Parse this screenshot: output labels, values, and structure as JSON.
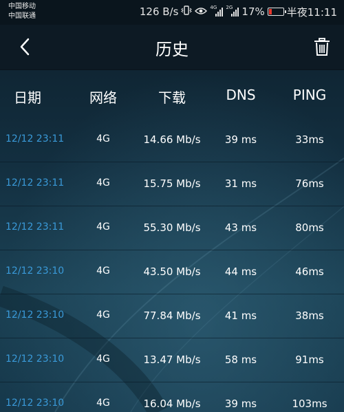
{
  "status_bar": {
    "carrier_1": "中国移动",
    "carrier_2": "中国联通",
    "speed": "126 B/s",
    "net_1": "4G",
    "net_2": "2G",
    "battery": "17%",
    "time": "半夜11:11"
  },
  "app_bar": {
    "title": "历史"
  },
  "table": {
    "headers": [
      "日期",
      "网络",
      "下载",
      "DNS",
      "PING"
    ],
    "rows": [
      {
        "date": "12/12 23:11",
        "network": "4G",
        "download": "14.66 Mb/s",
        "dns": "39 ms",
        "ping": "33ms"
      },
      {
        "date": "12/12 23:11",
        "network": "4G",
        "download": "15.75 Mb/s",
        "dns": "31 ms",
        "ping": "76ms"
      },
      {
        "date": "12/12 23:11",
        "network": "4G",
        "download": "55.30 Mb/s",
        "dns": "43 ms",
        "ping": "80ms"
      },
      {
        "date": "12/12 23:10",
        "network": "4G",
        "download": "43.50 Mb/s",
        "dns": "44 ms",
        "ping": "46ms"
      },
      {
        "date": "12/12 23:10",
        "network": "4G",
        "download": "77.84 Mb/s",
        "dns": "41 ms",
        "ping": "38ms"
      },
      {
        "date": "12/12 23:10",
        "network": "4G",
        "download": "13.47 Mb/s",
        "dns": "58 ms",
        "ping": "91ms"
      },
      {
        "date": "12/12 23:10",
        "network": "4G",
        "download": "16.04 Mb/s",
        "dns": "39 ms",
        "ping": "103ms"
      }
    ]
  },
  "colors": {
    "date_text": "#3a9ad9",
    "battery_low": "#e8372c"
  },
  "icons": [
    "back-arrow-icon",
    "trash-icon",
    "vibrate-icon",
    "eye-icon",
    "signal-icon",
    "battery-icon"
  ]
}
